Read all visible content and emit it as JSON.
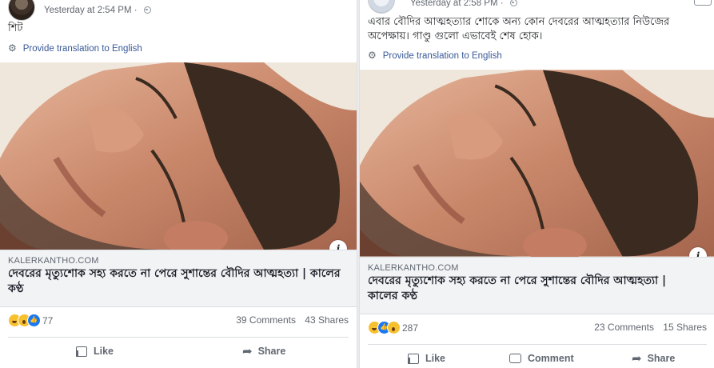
{
  "posts": [
    {
      "timestamp": "Yesterday at 2:54 PM",
      "separator": "·",
      "text": "শিট",
      "translate_label": "Provide translation to English",
      "link_domain": "KALERKANTHO.COM",
      "link_title": "দেবরের মৃত্যুশোক সহ্য করতে না পেরে সুশান্তের বৌদির আত্মহত্যা | কালের কণ্ঠ",
      "reaction_count": "77",
      "comments": "39 Comments",
      "shares": "43 Shares",
      "actions": {
        "like": "Like",
        "share": "Share"
      }
    },
    {
      "timestamp": "Yesterday at 2:58 PM",
      "separator": "·",
      "text": "এবার বৌদির আত্মহত্যার শোকে অন্য কোন দেবরের আত্মহত্যার নিউজের অপেক্ষায়। গাণ্ডু গুলো এভাবেই শেষ হোক।",
      "translate_label": "Provide translation to English",
      "link_domain": "KALERKANTHO.COM",
      "link_title": "দেবরের মৃত্যুশোক সহ্য করতে না পেরে সুশান্তের বৌদির আত্মহত্যা | কালের কণ্ঠ",
      "reaction_count": "287",
      "comments": "23 Comments",
      "shares": "15 Shares",
      "actions": {
        "like": "Like",
        "comment": "Comment",
        "share": "Share"
      }
    }
  ],
  "icons": {
    "globe": "globe-icon",
    "gear": "gear-icon",
    "info": "info-icon",
    "like": "like-icon",
    "comment": "comment-icon",
    "share": "share-icon",
    "more": "more-options-icon"
  },
  "colors": {
    "link": "#385898",
    "secondary_text": "#606770",
    "like_blue": "#1877f2",
    "reaction_yellow": "#f7c02e"
  }
}
